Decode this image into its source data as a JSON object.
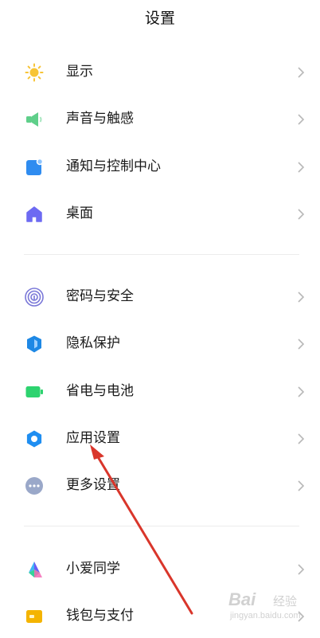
{
  "header": {
    "title": "设置"
  },
  "groups": [
    {
      "items": [
        {
          "label": "显示",
          "icon": "sun-icon",
          "color": "#f7c436"
        },
        {
          "label": "声音与触感",
          "icon": "speaker-icon",
          "color": "#5fcf8a"
        },
        {
          "label": "通知与控制中心",
          "icon": "notification-icon",
          "color": "#2f8cf0"
        },
        {
          "label": "桌面",
          "icon": "home-icon",
          "color": "#6d6af2"
        }
      ]
    },
    {
      "items": [
        {
          "label": "密码与安全",
          "icon": "fingerprint-icon",
          "color": "#7a78d8"
        },
        {
          "label": "隐私保护",
          "icon": "shield-icon",
          "color": "#1e88e5"
        },
        {
          "label": "省电与电池",
          "icon": "battery-icon",
          "color": "#2dd36f"
        },
        {
          "label": "应用设置",
          "icon": "gear-icon",
          "color": "#1f8ef1"
        },
        {
          "label": "更多设置",
          "icon": "more-dots-icon",
          "color": "#9aa8c9"
        }
      ]
    },
    {
      "items": [
        {
          "label": "小爱同学",
          "icon": "xiaoai-icon",
          "color": "#6a5ef5"
        },
        {
          "label": "钱包与支付",
          "icon": "wallet-icon",
          "color": "#f4b400"
        }
      ]
    }
  ],
  "annotation": {
    "arrow_color": "#d9362b"
  },
  "watermark": {
    "brand": "Bai",
    "cn": "经验",
    "url": "jingyan.baidu.com"
  }
}
